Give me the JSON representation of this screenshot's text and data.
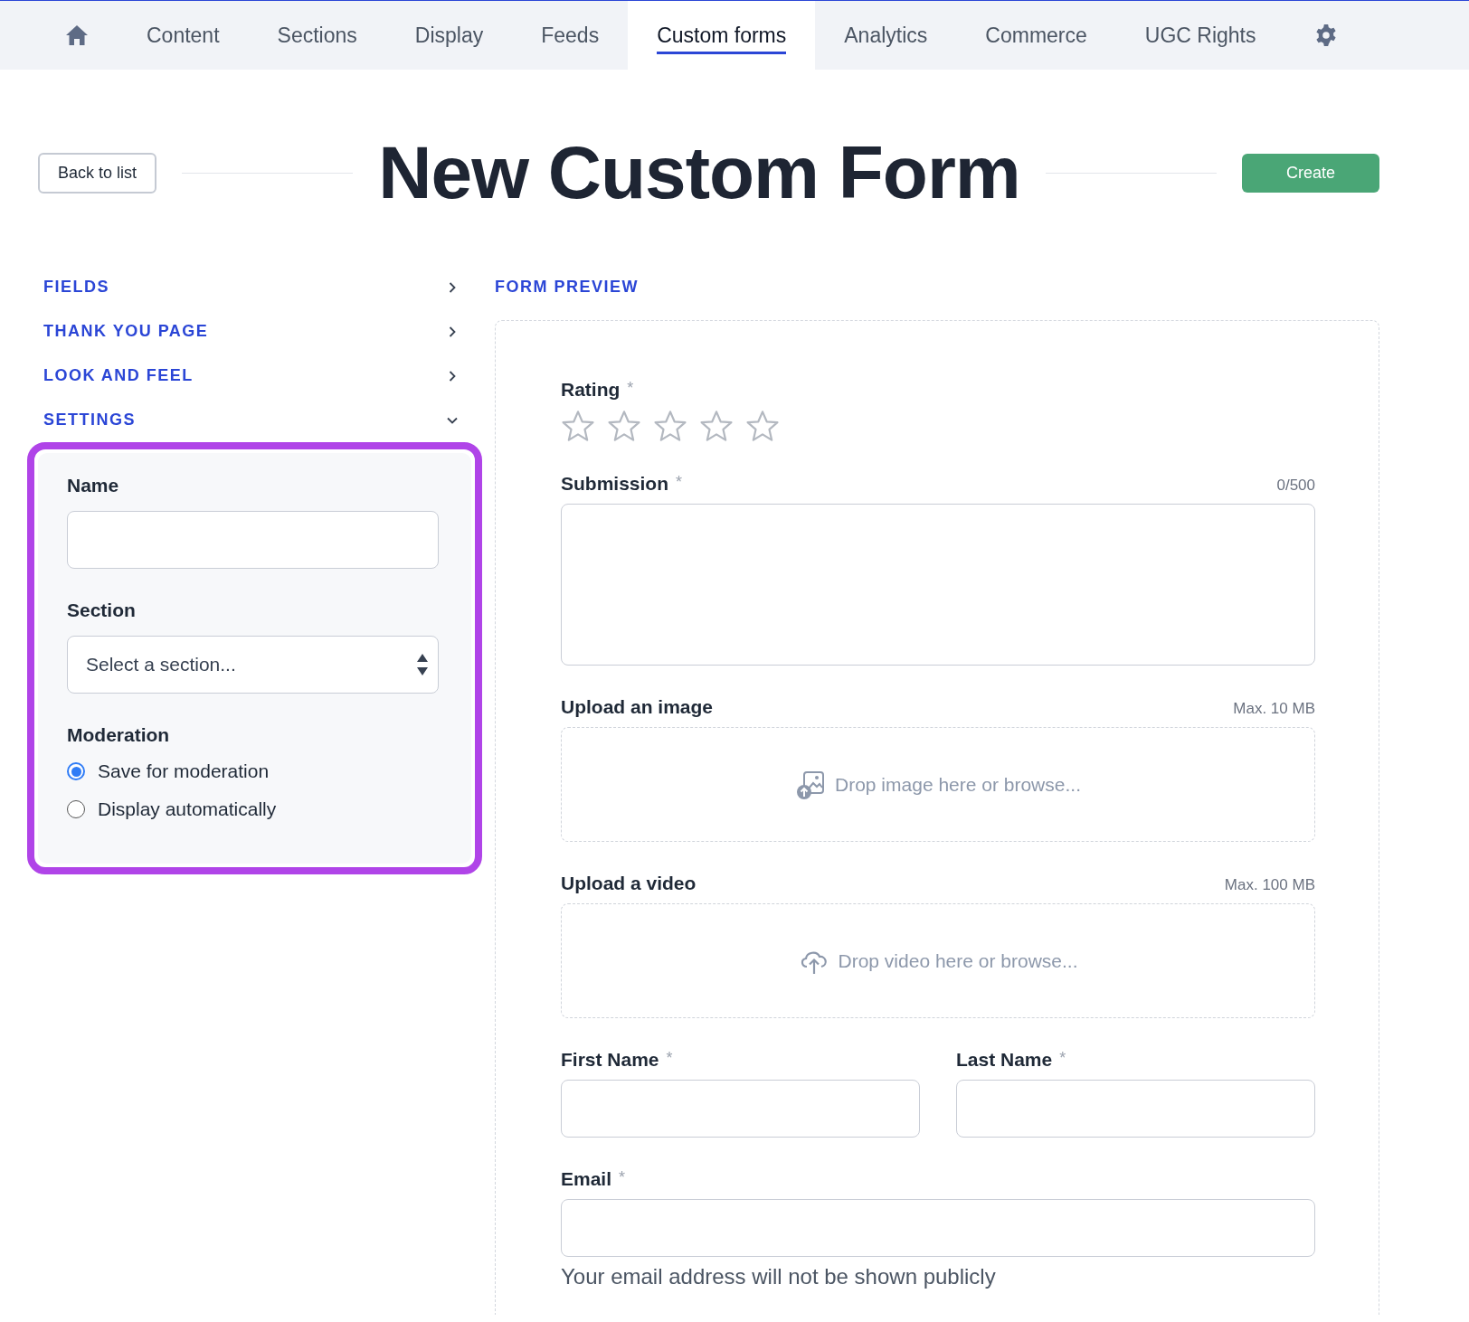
{
  "nav": {
    "tabs": [
      {
        "kind": "home",
        "selected": false
      },
      {
        "kind": "text",
        "label": "Content",
        "selected": false
      },
      {
        "kind": "text",
        "label": "Sections",
        "selected": false
      },
      {
        "kind": "text",
        "label": "Display",
        "selected": false
      },
      {
        "kind": "text",
        "label": "Feeds",
        "selected": false
      },
      {
        "kind": "text",
        "label": "Custom forms",
        "selected": true
      },
      {
        "kind": "text",
        "label": "Analytics",
        "selected": false
      },
      {
        "kind": "text",
        "label": "Commerce",
        "selected": false
      },
      {
        "kind": "text",
        "label": "UGC Rights",
        "selected": false
      },
      {
        "kind": "settings",
        "selected": false
      }
    ]
  },
  "header": {
    "back_button": "Back to list",
    "title": "New Custom Form",
    "create_button": "Create"
  },
  "sidebar": {
    "sections": [
      {
        "label": "FIELDS",
        "expanded": false
      },
      {
        "label": "THANK YOU PAGE",
        "expanded": false
      },
      {
        "label": "LOOK AND FEEL",
        "expanded": false
      },
      {
        "label": "SETTINGS",
        "expanded": true
      }
    ],
    "settings": {
      "name_label": "Name",
      "section_label": "Section",
      "section_placeholder": "Select a section...",
      "moderation_label": "Moderation",
      "moderation_options": [
        {
          "label": "Save for moderation",
          "selected": true
        },
        {
          "label": "Display automatically",
          "selected": false
        }
      ]
    }
  },
  "preview": {
    "title": "FORM PREVIEW",
    "fields": [
      {
        "kind": "rating",
        "label": "Rating",
        "required_mark": "*",
        "stars": 0
      },
      {
        "kind": "textarea",
        "label": "Submission",
        "required_mark": "*",
        "counter": "0/500"
      },
      {
        "kind": "image_upload",
        "label": "Upload an image",
        "limit": "Max. 10 MB",
        "drop_text": "Drop image here or browse..."
      },
      {
        "kind": "video_upload",
        "label": "Upload a video",
        "limit": "Max. 100 MB",
        "drop_text": "Drop video here or browse..."
      },
      {
        "kind": "pair",
        "fields": [
          {
            "label": "First Name",
            "required_mark": "*"
          },
          {
            "label": "Last Name",
            "required_mark": "*"
          }
        ]
      },
      {
        "kind": "input",
        "label": "Email",
        "required_mark": "*",
        "hint": "Your email address will not be shown publicly"
      }
    ]
  }
}
